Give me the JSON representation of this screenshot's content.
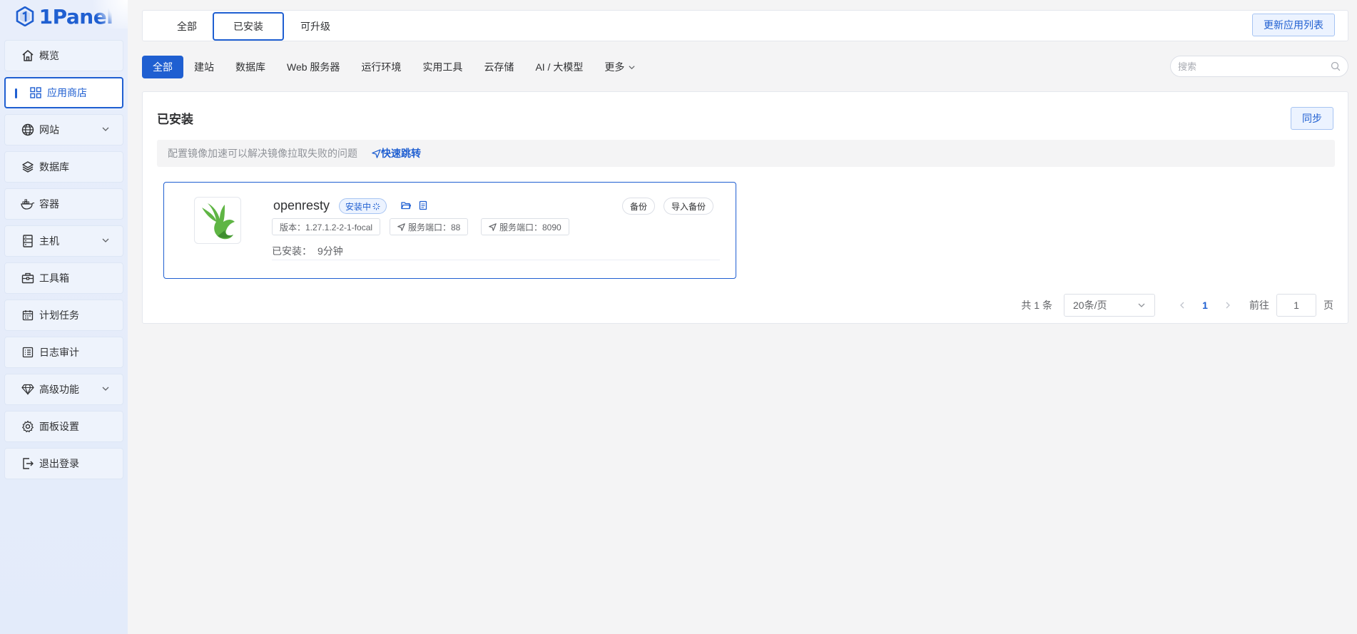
{
  "brand": {
    "name": "1Panel",
    "logo_icon": "hexagon-one-icon",
    "accent": "#1f5fd1"
  },
  "sidebar": {
    "items": [
      {
        "label": "概览",
        "icon": "home-icon"
      },
      {
        "label": "应用商店",
        "icon": "grid-icon",
        "active": true
      },
      {
        "label": "网站",
        "icon": "globe-icon",
        "expandable": true
      },
      {
        "label": "数据库",
        "icon": "layers-icon"
      },
      {
        "label": "容器",
        "icon": "docker-icon"
      },
      {
        "label": "主机",
        "icon": "server-icon",
        "expandable": true
      },
      {
        "label": "工具箱",
        "icon": "toolbox-icon"
      },
      {
        "label": "计划任务",
        "icon": "calendar-icon"
      },
      {
        "label": "日志审计",
        "icon": "log-icon"
      },
      {
        "label": "高级功能",
        "icon": "diamond-icon",
        "expandable": true
      },
      {
        "label": "面板设置",
        "icon": "gear-icon"
      },
      {
        "label": "退出登录",
        "icon": "logout-icon"
      }
    ]
  },
  "top_tabs": [
    {
      "label": "全部"
    },
    {
      "label": "已安装",
      "active": true
    },
    {
      "label": "可升级"
    }
  ],
  "refresh_button": "更新应用列表",
  "categories": [
    {
      "label": "全部",
      "active": true
    },
    {
      "label": "建站"
    },
    {
      "label": "数据库"
    },
    {
      "label": "Web 服务器"
    },
    {
      "label": "运行环境"
    },
    {
      "label": "实用工具"
    },
    {
      "label": "云存储"
    },
    {
      "label": "AI / 大模型"
    },
    {
      "label": "更多"
    }
  ],
  "search": {
    "placeholder": "搜索",
    "value": ""
  },
  "panel": {
    "title": "已安装",
    "sync_button": "同步",
    "notice": "配置镜像加速可以解决镜像拉取失败的问题",
    "notice_link": "快速跳转"
  },
  "app": {
    "name": "openresty",
    "status": "安装中",
    "backup_button": "备份",
    "import_backup_button": "导入备份",
    "version_tag": "版本：1.27.1.2-2-1-focal",
    "port_tag_1": "服务端口：88",
    "port_tag_2": "服务端口：8090",
    "installed_label": "已安装：",
    "installed_value": "9分钟"
  },
  "pagination": {
    "total": "共 1 条",
    "page_size": "20条/页",
    "current_page": "1",
    "goto_label": "前往",
    "goto_value": "1",
    "page_suffix": "页"
  }
}
